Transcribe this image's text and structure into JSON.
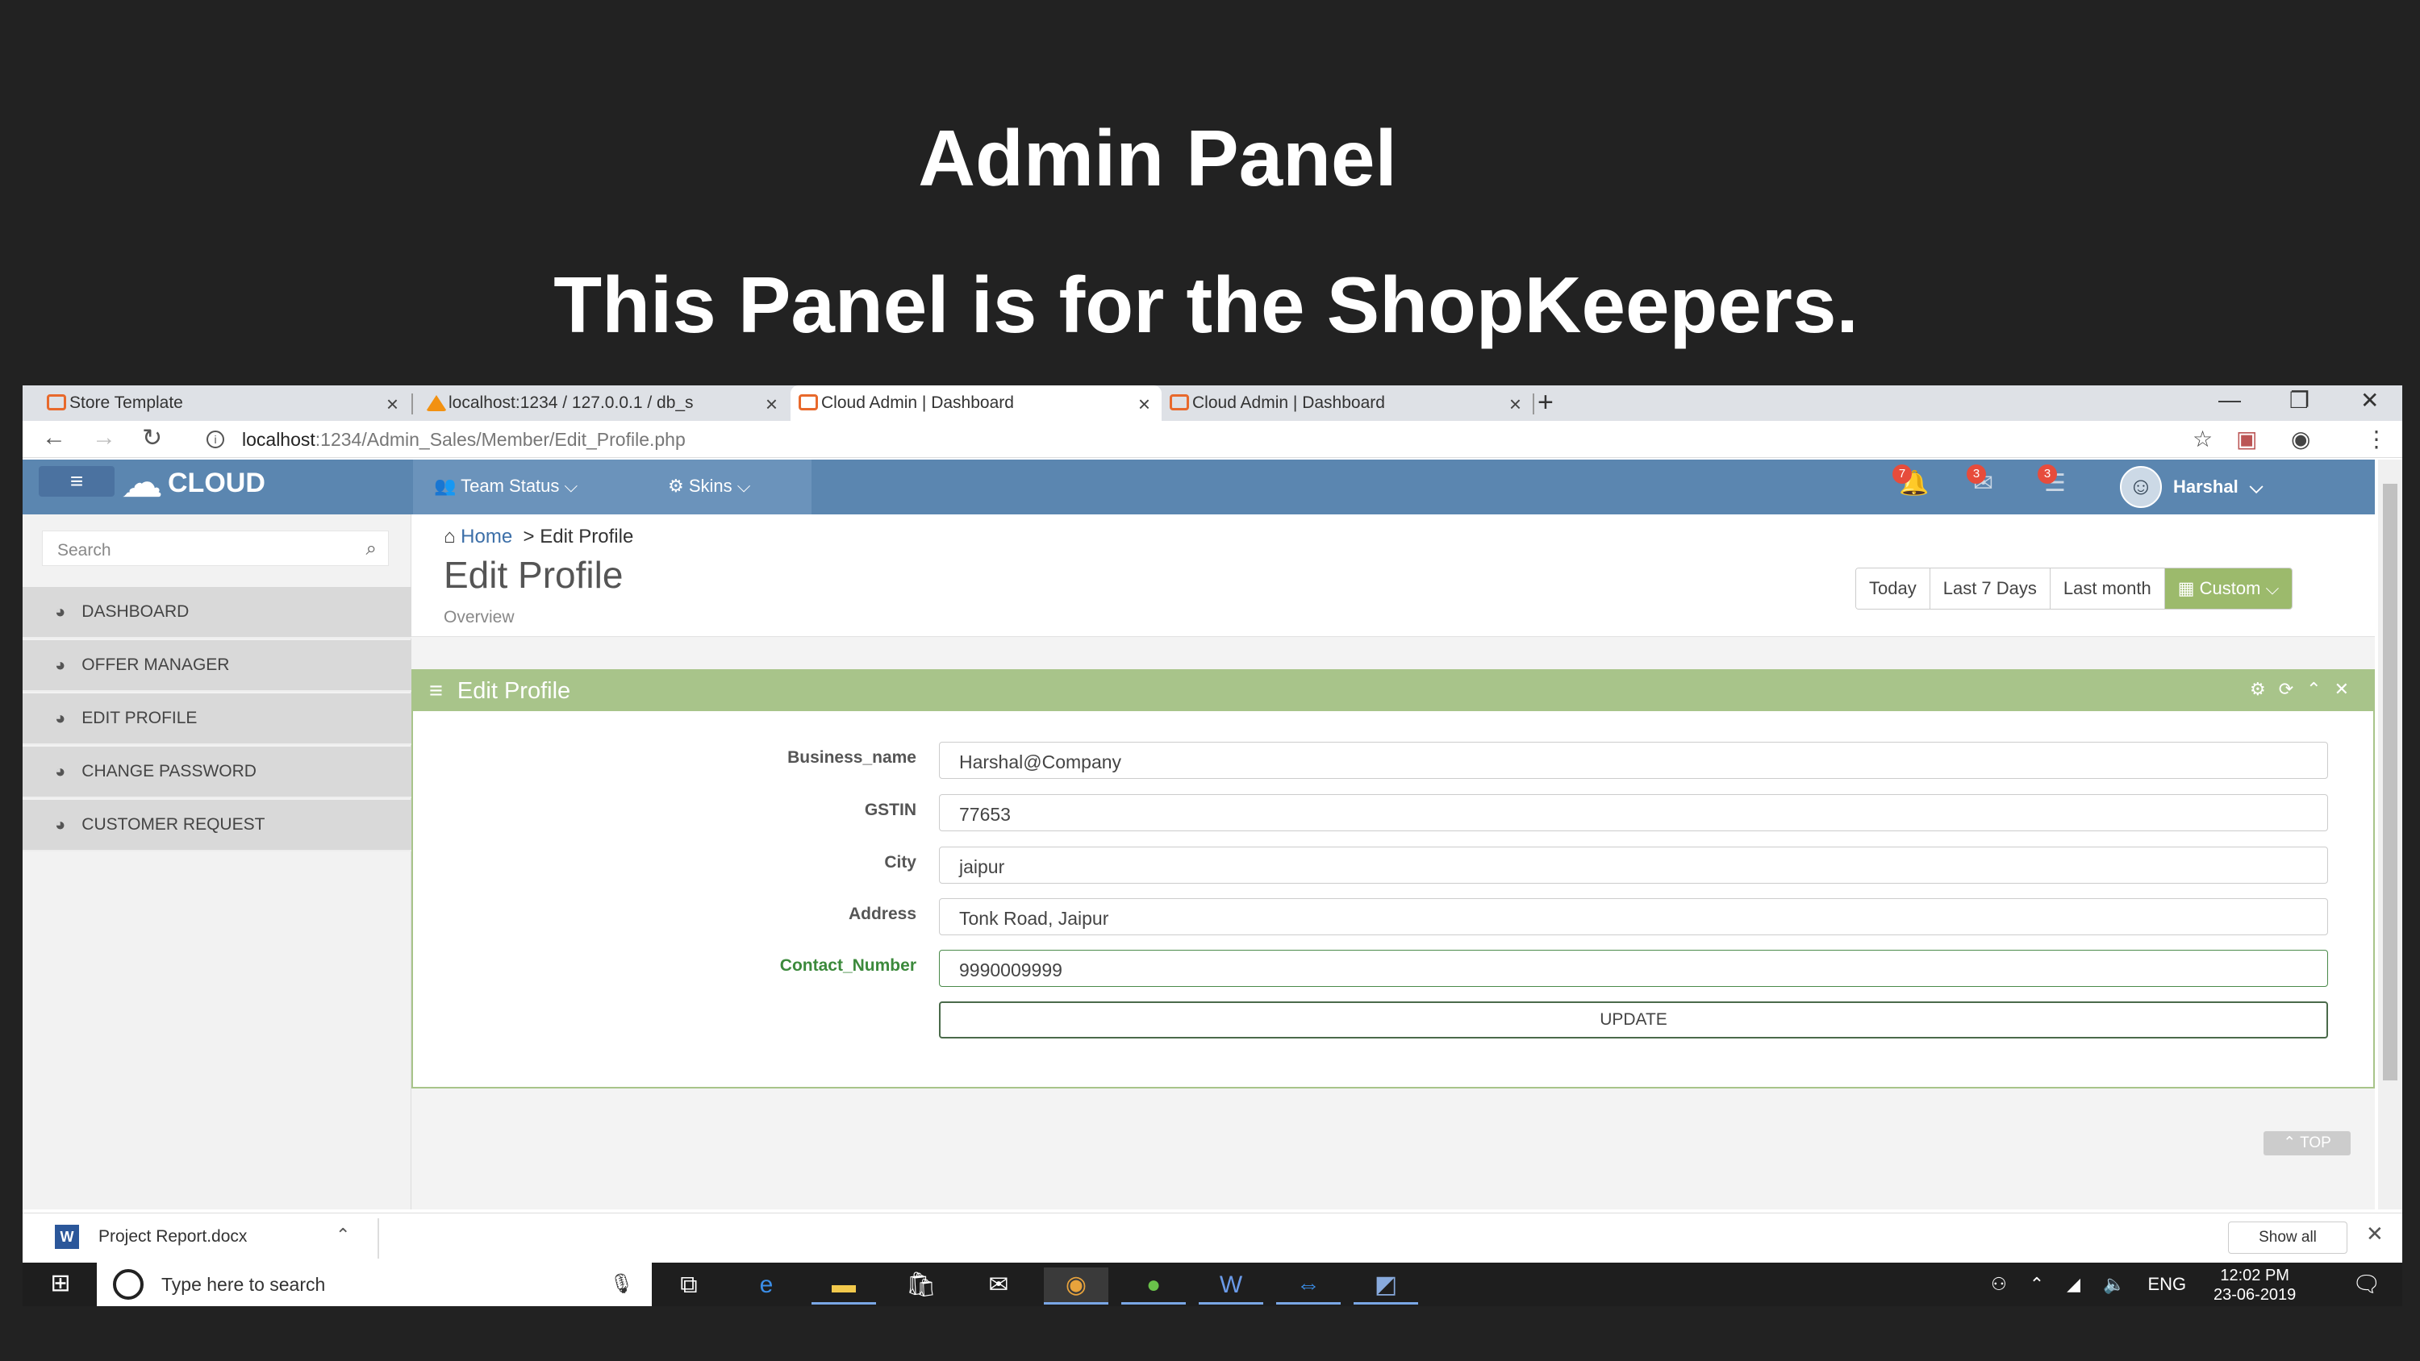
{
  "slide": {
    "title": "Admin Panel",
    "subtitle": "This Panel is for the ShopKeepers."
  },
  "browser": {
    "tabs": [
      {
        "label": "Store Template",
        "active": false
      },
      {
        "label": "localhost:1234 / 127.0.0.1 / db_s",
        "active": false
      },
      {
        "label": "Cloud Admin | Dashboard",
        "active": true
      },
      {
        "label": "Cloud Admin | Dashboard",
        "active": false
      }
    ],
    "url_host": "localhost",
    "url_path": ":1234/Admin_Sales/Member/Edit_Profile.php"
  },
  "header": {
    "logo": "CLOUD",
    "nav": [
      {
        "label": "Team Status",
        "icon": "users-icon"
      },
      {
        "label": "Skins",
        "icon": "gear-icon"
      }
    ],
    "badges": [
      {
        "count": "7",
        "icon": "bell-icon"
      },
      {
        "count": "3",
        "icon": "envelope-icon"
      },
      {
        "count": "3",
        "icon": "tasks-icon"
      }
    ],
    "user_name": "Harshal"
  },
  "sidebar": {
    "search_placeholder": "Search",
    "items": [
      {
        "label": "DASHBOARD"
      },
      {
        "label": "OFFER MANAGER"
      },
      {
        "label": "EDIT PROFILE"
      },
      {
        "label": "CHANGE PASSWORD"
      },
      {
        "label": "CUSTOMER REQUEST"
      }
    ]
  },
  "page": {
    "breadcrumb_home": "Home",
    "breadcrumb_current": "Edit Profile",
    "title": "Edit Profile",
    "subtitle": "Overview",
    "date_buttons": [
      "Today",
      "Last 7 Days",
      "Last month",
      "Custom"
    ]
  },
  "form": {
    "box_title": "Edit Profile",
    "fields": [
      {
        "label": "Business_name",
        "value": "Harshal@Company"
      },
      {
        "label": "GSTIN",
        "value": "77653"
      },
      {
        "label": "City",
        "value": "jaipur"
      },
      {
        "label": "Address",
        "value": "Tonk Road, Jaipur"
      },
      {
        "label": "Contact_Number",
        "value": "9990009999"
      }
    ],
    "submit_label": "UPDATE",
    "top_label": "TOP"
  },
  "downloads": {
    "file": "Project Report.docx",
    "show_all": "Show all"
  },
  "taskbar": {
    "search_placeholder": "Type here to search",
    "lang": "ENG",
    "time": "12:02 PM",
    "date": "23-06-2019"
  }
}
